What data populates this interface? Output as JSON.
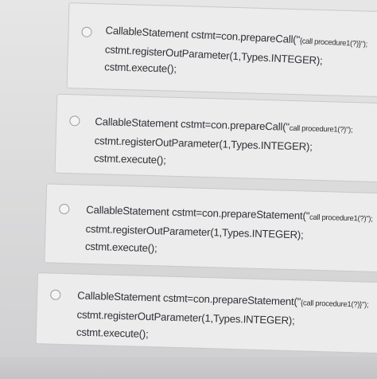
{
  "options": [
    {
      "line1_main": "CallableStatement cstmt=con.prepareCall(\"",
      "line1_small": "{call procedure1(?)}\");",
      "line2": "cstmt.registerOutParameter(1,Types.INTEGER);",
      "line3": "cstmt.execute();"
    },
    {
      "line1_main": "CallableStatement cstmt=con.prepareCall(\"",
      "line1_small": "call procedure1(?)\");",
      "line2": "cstmt.registerOutParameter(1,Types.INTEGER);",
      "line3": "cstmt.execute();"
    },
    {
      "line1_main": "CallableStatement cstmt=con.prepareStatement(\"",
      "line1_small": "call procedure1(?)\");",
      "line2": "cstmt.registerOutParameter(1,Types.INTEGER);",
      "line3": "cstmt.execute();"
    },
    {
      "line1_main": "CallableStatement cstmt=con.prepareStatement(\"",
      "line1_small": "{call procedure1(?)}\");",
      "line2": "cstmt.registerOutParameter(1,Types.INTEGER);",
      "line3": "cstmt.execute();"
    }
  ]
}
